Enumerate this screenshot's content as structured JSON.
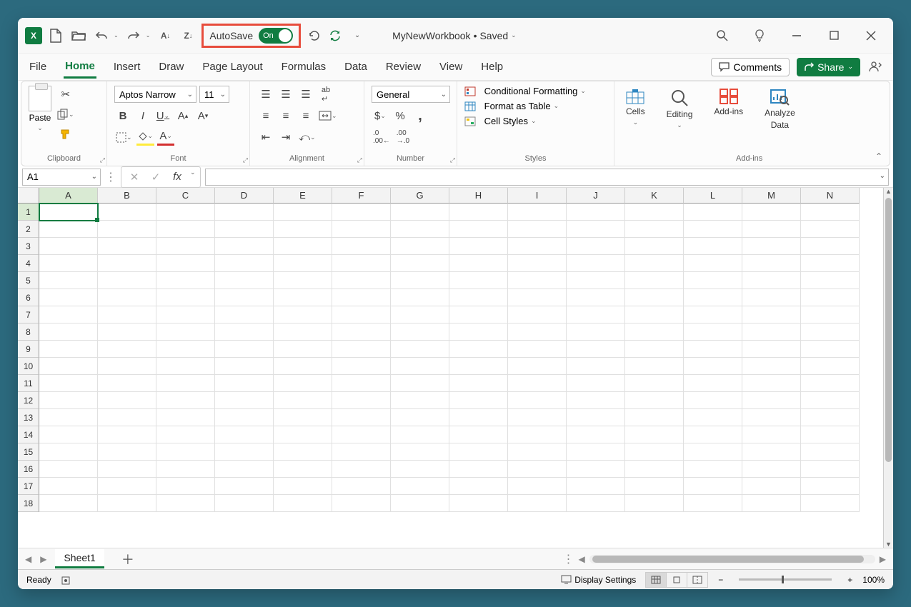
{
  "app": {
    "logo_letter": "X"
  },
  "qat": {
    "autosave_label": "AutoSave",
    "autosave_state": "On"
  },
  "title": {
    "workbook": "MyNewWorkbook",
    "status": "Saved"
  },
  "tabs": {
    "file": "File",
    "home": "Home",
    "insert": "Insert",
    "draw": "Draw",
    "page_layout": "Page Layout",
    "formulas": "Formulas",
    "data": "Data",
    "review": "Review",
    "view": "View",
    "help": "Help",
    "comments": "Comments",
    "share": "Share"
  },
  "ribbon": {
    "clipboard": {
      "paste": "Paste",
      "label": "Clipboard"
    },
    "font": {
      "name": "Aptos Narrow",
      "size": "11",
      "bold": "B",
      "italic": "I",
      "underline": "U",
      "label": "Font"
    },
    "alignment": {
      "label": "Alignment"
    },
    "number": {
      "format": "General",
      "label": "Number"
    },
    "styles": {
      "cond": "Conditional Formatting",
      "table": "Format as Table",
      "cell": "Cell Styles",
      "label": "Styles"
    },
    "cells": {
      "label": "Cells"
    },
    "editing": {
      "label": "Editing"
    },
    "addins": {
      "btn": "Add-ins",
      "label": "Add-ins"
    },
    "analyze": {
      "l1": "Analyze",
      "l2": "Data"
    }
  },
  "formula": {
    "namebox": "A1",
    "fx": "fx",
    "value": ""
  },
  "grid": {
    "columns": [
      "A",
      "B",
      "C",
      "D",
      "E",
      "F",
      "G",
      "H",
      "I",
      "J",
      "K",
      "L",
      "M",
      "N"
    ],
    "rows": [
      "1",
      "2",
      "3",
      "4",
      "5",
      "6",
      "7",
      "8",
      "9",
      "10",
      "11",
      "12",
      "13",
      "14",
      "15",
      "16",
      "17",
      "18"
    ],
    "selected_col": "A",
    "selected_row": "1"
  },
  "sheets": {
    "active": "Sheet1"
  },
  "status": {
    "ready": "Ready",
    "display": "Display Settings",
    "zoom": "100%"
  }
}
